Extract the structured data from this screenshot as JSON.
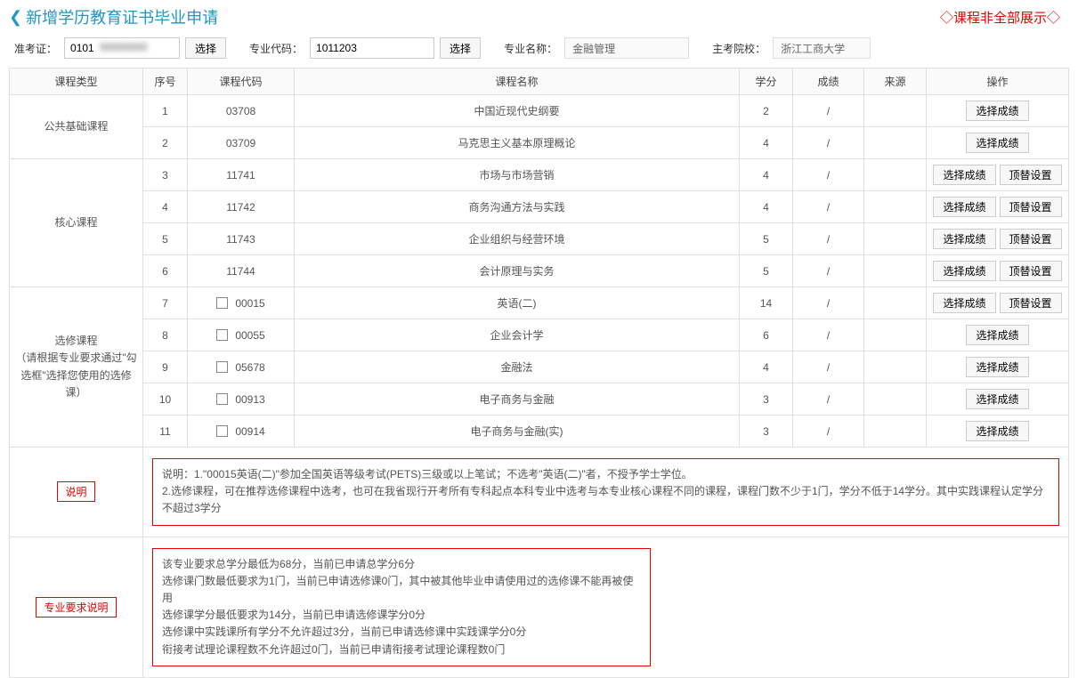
{
  "header": {
    "title": "新增学历教育证书毕业申请",
    "warning": "◇课程非全部展示◇"
  },
  "filters": {
    "exam_id_label": "准考证：",
    "exam_id_value": "0101",
    "exam_id_blur": "00000000",
    "select_btn": "选择",
    "major_code_label": "专业代码：",
    "major_code_value": "1011203",
    "major_name_label": "专业名称：",
    "major_name_value": "金融管理",
    "school_label": "主考院校：",
    "school_value": "浙江工商大学"
  },
  "columns": {
    "type": "课程类型",
    "seq": "序号",
    "code": "课程代码",
    "name": "课程名称",
    "credit": "学分",
    "score": "成绩",
    "source": "来源",
    "op": "操作"
  },
  "groups": [
    {
      "type_label": "公共基础课程",
      "rows": [
        {
          "seq": "1",
          "code": "03708",
          "name": "中国近现代史纲要",
          "credit": "2",
          "score": "/",
          "source": "",
          "checkbox": false,
          "ops": [
            "选择成绩"
          ]
        },
        {
          "seq": "2",
          "code": "03709",
          "name": "马克思主义基本原理概论",
          "credit": "4",
          "score": "/",
          "source": "",
          "checkbox": false,
          "ops": [
            "选择成绩"
          ]
        }
      ]
    },
    {
      "type_label": "核心课程",
      "rows": [
        {
          "seq": "3",
          "code": "11741",
          "name": "市场与市场营销",
          "credit": "4",
          "score": "/",
          "source": "",
          "checkbox": false,
          "ops": [
            "选择成绩",
            "顶替设置"
          ]
        },
        {
          "seq": "4",
          "code": "11742",
          "name": "商务沟通方法与实践",
          "credit": "4",
          "score": "/",
          "source": "",
          "checkbox": false,
          "ops": [
            "选择成绩",
            "顶替设置"
          ]
        },
        {
          "seq": "5",
          "code": "11743",
          "name": "企业组织与经营环境",
          "credit": "5",
          "score": "/",
          "source": "",
          "checkbox": false,
          "ops": [
            "选择成绩",
            "顶替设置"
          ]
        },
        {
          "seq": "6",
          "code": "11744",
          "name": "会计原理与实务",
          "credit": "5",
          "score": "/",
          "source": "",
          "checkbox": false,
          "ops": [
            "选择成绩",
            "顶替设置"
          ]
        }
      ]
    },
    {
      "type_label": "选修课程\n（请根据专业要求通过\"勾选框\"选择您使用的选修课）",
      "rows": [
        {
          "seq": "7",
          "code": "00015",
          "name": "英语(二)",
          "credit": "14",
          "score": "/",
          "source": "",
          "checkbox": true,
          "ops": [
            "选择成绩",
            "顶替设置"
          ]
        },
        {
          "seq": "8",
          "code": "00055",
          "name": "企业会计学",
          "credit": "6",
          "score": "/",
          "source": "",
          "checkbox": true,
          "ops": [
            "选择成绩"
          ]
        },
        {
          "seq": "9",
          "code": "05678",
          "name": "金融法",
          "credit": "4",
          "score": "/",
          "source": "",
          "checkbox": true,
          "ops": [
            "选择成绩"
          ]
        },
        {
          "seq": "10",
          "code": "00913",
          "name": "电子商务与金融",
          "credit": "3",
          "score": "/",
          "source": "",
          "checkbox": true,
          "ops": [
            "选择成绩"
          ]
        },
        {
          "seq": "11",
          "code": "00914",
          "name": "电子商务与金融(实)",
          "credit": "3",
          "score": "/",
          "source": "",
          "checkbox": true,
          "ops": [
            "选择成绩"
          ]
        }
      ]
    }
  ],
  "notes": {
    "desc_label": "说明",
    "desc_text": "说明：1.\"00015英语(二)\"参加全国英语等级考试(PETS)三级或以上笔试；不选考\"英语(二)\"者，不授予学士学位。\n2.选修课程，可在推荐选修课程中选考，也可在我省现行开考所有专科起点本科专业中选考与本专业核心课程不同的课程，课程门数不少于1门，学分不低于14学分。其中实践课程认定学分不超过3学分",
    "req_label": "专业要求说明",
    "req_text": "该专业要求总学分最低为68分，当前已申请总学分6分\n选修课门数最低要求为1门，当前已申请选修课0门，其中被其他毕业申请使用过的选修课不能再被使用\n选修课学分最低要求为14分，当前已申请选修课学分0分\n选修课中实践课所有学分不允许超过3分，当前已申请选修课中实践课学分0分\n衔接考试理论课程数不允许超过0门，当前已申请衔接考试理论课程数0门"
  }
}
